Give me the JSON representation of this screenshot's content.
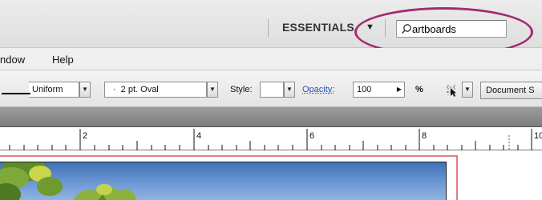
{
  "workspace": {
    "label": "ESSENTIALS",
    "arrow": "▼"
  },
  "search": {
    "value": "artboards",
    "icon": "search-icon"
  },
  "menu": {
    "items": [
      "ndow",
      "Help"
    ]
  },
  "control_bar": {
    "stroke_profile": "Uniform",
    "brush": "2 pt. Oval",
    "brush_prefix": "·",
    "style_label": "Style:",
    "opacity_label": "Opacity:",
    "opacity_value": "100",
    "percent": "%",
    "document_setup": "Document S"
  },
  "ruler": {
    "labels": [
      "2",
      "4",
      "6",
      "8",
      "10"
    ]
  },
  "colors": {
    "highlight": "#a22b72",
    "artboard_border": "#e37c86",
    "link": "#2b4fc9"
  }
}
